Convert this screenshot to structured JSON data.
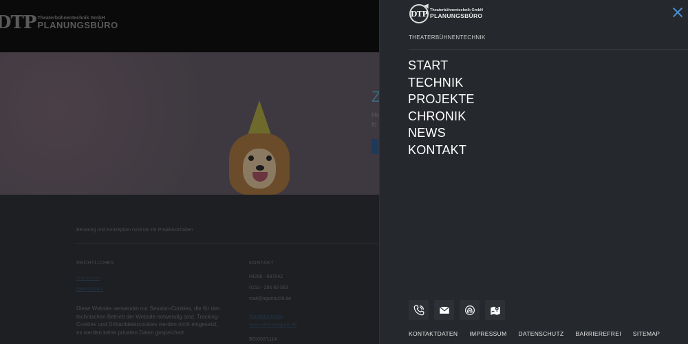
{
  "background": {
    "logo_mark": "DTP",
    "logo_small": "Theaterbühnentechnik GmbH",
    "logo_big": "PLANUNGSBÜRO",
    "hero_title": "Z",
    "hero_text1": "Ho",
    "hero_text2": "fo",
    "footer_tagline": "Beratung und Konzeption rund um Ihr Projektvorhaben",
    "footer_left_heading": "RECHTLICHES",
    "footer_left_link1": "Impressum",
    "footer_left_link2": "Datenschutz",
    "cookie_text": "Diese Website verwendet nur Session-Cookies, die für den technischen Betrieb der Website notwendig sind. Tracking-Cookies und Drittanbietercookies werden nicht eingesetzt, es werden keine privaten Daten gespeichert.",
    "footer_right_heading": "KONTAKT",
    "phone1": "04298 - 697042",
    "phone2": "0152 - 295 60 583",
    "email": "mail@agentur28.de",
    "link1": "Kontaktformular",
    "link2": "www.weltstrasgruis.de",
    "vat": "BG/002/1114"
  },
  "panel": {
    "logo_mark": "DTP",
    "logo_small": "Theaterbühnentechnik GmbH",
    "logo_big": "PLANUNGSBÜRO",
    "section": "THEATERBÜHNENTECHNIK",
    "nav": [
      "START",
      "TECHNIK",
      "PROJEKTE",
      "CHRONIK",
      "NEWS",
      "KONTAKT"
    ],
    "icons": [
      "phone-icon",
      "mail-icon",
      "shape-icon",
      "map-icon"
    ],
    "footer_links": [
      "KONTAKTDATEN",
      "IMPRESSUM",
      "DATENSCHUTZ",
      "BARRIEREFREI",
      "SITEMAP"
    ],
    "close_color": "#4a8fd6"
  }
}
